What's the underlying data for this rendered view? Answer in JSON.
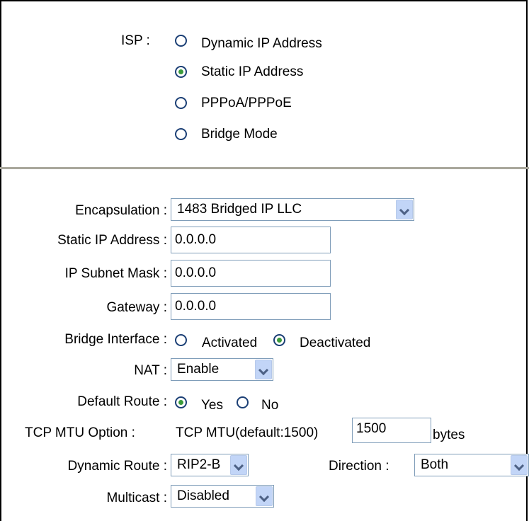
{
  "isp": {
    "label": "ISP :",
    "options": [
      {
        "label": "Dynamic IP Address",
        "checked": false
      },
      {
        "label": "Static IP Address",
        "checked": true
      },
      {
        "label": "PPPoA/PPPoE",
        "checked": false
      },
      {
        "label": "Bridge Mode",
        "checked": false
      }
    ]
  },
  "form": {
    "encapsulation_label": "Encapsulation :",
    "encapsulation_value": "1483 Bridged IP LLC",
    "static_ip_label": "Static IP Address :",
    "static_ip_value": "0.0.0.0",
    "subnet_label": "IP Subnet Mask :",
    "subnet_value": "0.0.0.0",
    "gateway_label": "Gateway :",
    "gateway_value": "0.0.0.0",
    "bridge_label": "Bridge Interface :",
    "bridge_activated": "Activated",
    "bridge_deactivated": "Deactivated",
    "nat_label": "NAT :",
    "nat_value": "Enable",
    "default_route_label": "Default Route :",
    "default_route_yes": "Yes",
    "default_route_no": "No",
    "mtu_label": "TCP MTU Option :",
    "mtu_text": "TCP MTU(default:1500)",
    "mtu_value": "1500",
    "mtu_unit": "bytes",
    "dynamic_route_label": "Dynamic Route :",
    "dynamic_route_value": "RIP2-B",
    "direction_label": "Direction :",
    "direction_value": "Both",
    "multicast_label": "Multicast :",
    "multicast_value": "Disabled"
  },
  "colors": {
    "radio_border": "#1b3f75",
    "radio_dot": "#3a9a3a",
    "divider": "#a9a79c",
    "input_border": "#7f9db9"
  }
}
